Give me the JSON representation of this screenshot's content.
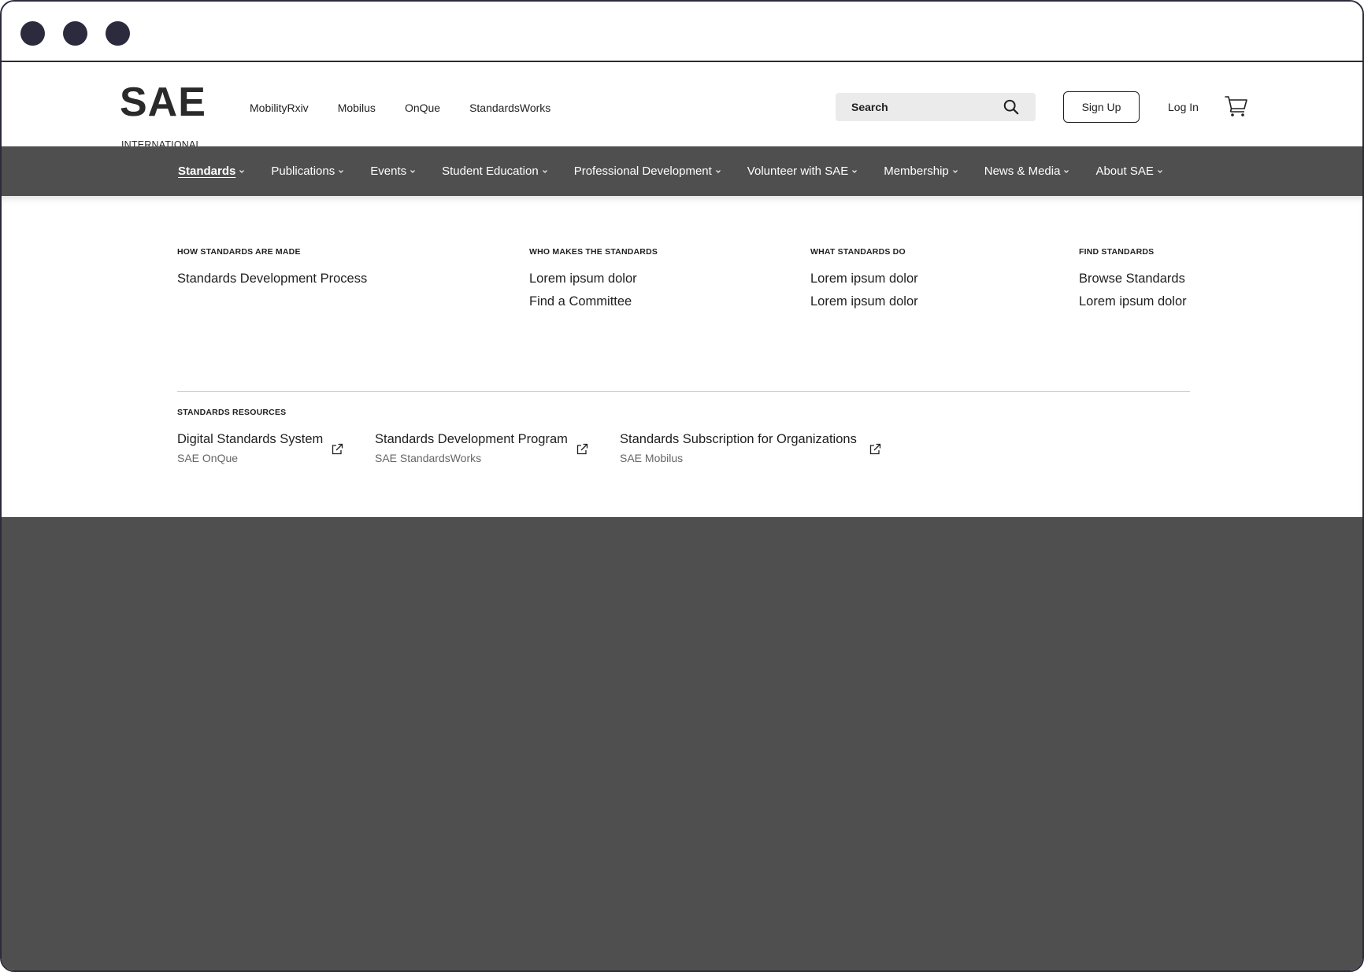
{
  "header": {
    "logo_main": "SAE",
    "logo_sub": "INTERNATIONAL",
    "top_links": [
      "MobilityRxiv",
      "Mobilus",
      "OnQue",
      "StandardsWorks"
    ],
    "search_placeholder": "Search",
    "signup_label": "Sign Up",
    "login_label": "Log In"
  },
  "nav": {
    "items": [
      {
        "label": "Standards",
        "active": true
      },
      {
        "label": "Publications"
      },
      {
        "label": "Events"
      },
      {
        "label": "Student Education"
      },
      {
        "label": "Professional Development"
      },
      {
        "label": "Volunteer with SAE"
      },
      {
        "label": "Membership"
      },
      {
        "label": "News & Media"
      },
      {
        "label": "About SAE"
      }
    ]
  },
  "mega": {
    "columns": [
      {
        "heading": "HOW STANDARDS ARE MADE",
        "links": [
          "Standards Development Process"
        ]
      },
      {
        "heading": "WHO MAKES THE STANDARDS",
        "links": [
          "Lorem ipsum dolor",
          "Find a Committee"
        ]
      },
      {
        "heading": "WHAT STANDARDS DO",
        "links": [
          "Lorem ipsum dolor",
          "Lorem ipsum dolor"
        ]
      },
      {
        "heading": "FIND STANDARDS",
        "links": [
          "Browse Standards",
          "Lorem ipsum dolor"
        ]
      }
    ],
    "resources_heading": "STANDARDS RESOURCES",
    "resources": [
      {
        "title": "Digital Standards System",
        "sub": "SAE OnQue"
      },
      {
        "title": "Standards Development Program",
        "sub": "SAE StandardsWorks"
      },
      {
        "title": "Standards Subscription for Organizations",
        "sub": "SAE Mobilus"
      }
    ]
  },
  "icons": {
    "window_dots": [
      "window-close-dot",
      "window-minimize-dot",
      "window-maximize-dot"
    ],
    "search": "search-icon",
    "cart": "cart-icon",
    "external": "external-link-icon",
    "caret": "chevron-down-icon"
  },
  "colors": {
    "nav_bg": "#4f4f4f",
    "overlay_bg": "#4f4f4f",
    "frame_border": "#2b2b3a",
    "search_bg": "#ebebeb"
  }
}
